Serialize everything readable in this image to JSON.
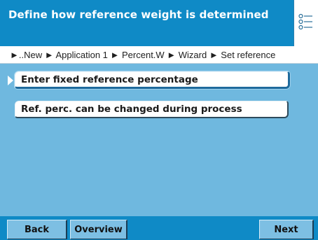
{
  "header": {
    "title": "Define how reference weight is determined",
    "menu_icon": "list-menu-icon"
  },
  "breadcrumb": {
    "text": "►..New ► Application 1 ► Percent.W ► Wizard ► Set reference"
  },
  "options": [
    {
      "label": "Enter fixed reference percentage",
      "selected": true
    },
    {
      "label": "Ref. perc. can be changed during process",
      "selected": false
    }
  ],
  "softkeys": {
    "back": "Back",
    "overview": "Overview",
    "next": "Next"
  },
  "colors": {
    "header": "#0f8ac6",
    "content": "#6fb8df",
    "softkey": "#7dbfe3"
  }
}
